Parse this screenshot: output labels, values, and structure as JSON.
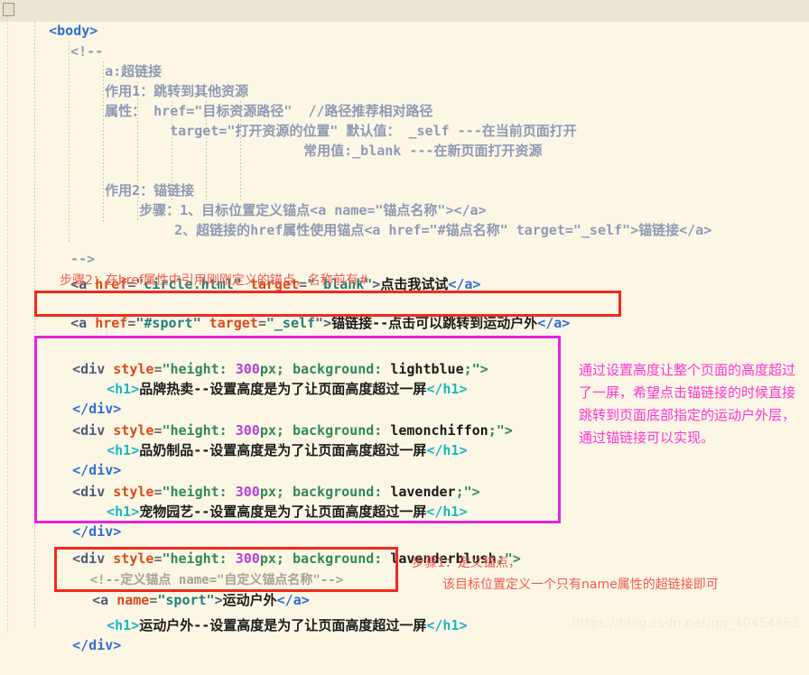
{
  "editor": {
    "language": "html",
    "background_color": "#fcf7e5",
    "current_line_highlight": "#eae5d2",
    "body_tag": "<body>",
    "comment_open": "<!--",
    "comment_close": "-->",
    "comment_lines": [
      "a:超链接",
      "作用1：跳转到其他资源",
      "属性： href=\"目标资源路径\"  //路径推荐相对路径",
      "target=\"打开资源的位置\" 默认值： _self ---在当前页面打开",
      "常用值:_blank ---在新页面打开资源",
      "作用2：锚链接",
      "步骤：1、目标位置定义锚点<a name=\"锚点名称\"></a>",
      "2、超链接的href属性使用锚点<a href=\"#锚点名称\" target=\"_self\">锚链接</a>"
    ],
    "link_circle": {
      "open": "<a ",
      "attr_href": "href",
      "eq": "=",
      "val_href": "\"circle.html\"",
      "attr_target": "target",
      "val_target": "\"_blank\"",
      "gt": ">",
      "text": "点击我试试",
      "close": "</a>"
    },
    "link_sport": {
      "open": "<a ",
      "attr_href": "href",
      "eq": "=",
      "val_href": "\"#sport\"",
      "attr_target": "target",
      "val_target": "\"_self\"",
      "gt": ">",
      "text": "锚链接--点击可以跳转到运动户外",
      "close": "</a>"
    },
    "anchor_def": {
      "comment": "<!--定义锚点 name=\"自定义锚点名称\"-->",
      "open": "<a ",
      "attr_name": "name",
      "eq": "=",
      "val_name": "\"sport\"",
      "gt": ">",
      "text": "运动户外",
      "close": "</a>"
    },
    "divs": [
      {
        "tag_open": "<div ",
        "attr": "style",
        "eq": "=",
        "quote": "\"",
        "prop1": "height: ",
        "num": "300",
        "unit": "px; ",
        "prop2": "background: ",
        "value": "lightblue",
        "tail": ";\">",
        "h1_open": "<h1>",
        "h1_text": "品牌热卖--设置高度是为了让页面高度超过一屏",
        "h1_close": "</h1>",
        "close": "</div>"
      },
      {
        "tag_open": "<div ",
        "attr": "style",
        "eq": "=",
        "quote": "\"",
        "prop1": "height: ",
        "num": "300",
        "unit": "px; ",
        "prop2": "background: ",
        "value": "lemonchiffon",
        "tail": ";\">",
        "h1_open": "<h1>",
        "h1_text": "品奶制品--设置高度是为了让页面高度超过一屏",
        "h1_close": "</h1>",
        "close": "</div>"
      },
      {
        "tag_open": "<div ",
        "attr": "style",
        "eq": "=",
        "quote": "\"",
        "prop1": "height: ",
        "num": "300",
        "unit": "px; ",
        "prop2": "background: ",
        "value": "lavender",
        "tail": ";\">",
        "h1_open": "<h1>",
        "h1_text": "宠物园艺--设置高度是为了让页面高度超过一屏",
        "h1_close": "</h1>",
        "close": "</div>"
      },
      {
        "tag_open": "<div ",
        "attr": "style",
        "eq": "=",
        "quote": "\"",
        "prop1": "height: ",
        "num": "300",
        "unit": "px; ",
        "prop2": "background: ",
        "value": "lavenderblush",
        "tail": ";\">",
        "h1_open": "<h1>",
        "h1_text": "运动户外--设置高度是为了让页面高度超过一屏",
        "h1_close": "</h1>",
        "close": "</div>"
      }
    ]
  },
  "annotations": {
    "step2_red": "步骤2：在href属性中引用刚刚定义的锚点，名称前有#",
    "step1_red_line1": "步骤1：定义锚点，",
    "step1_red_line2": "该目标位置定义一个只有name属性的超链接即可",
    "side_magenta": "通过设置高度让整个页面的高度超过了一屏，希望点击锚链接的时候直接跳转到页面底部指定的运动户外层，通过锚链接可以实现。",
    "colors": {
      "red_box": "#f5271f",
      "magenta_box": "#ea21e0",
      "red_text": "#f2584f",
      "magenta_text": "#ff34d2"
    }
  },
  "watermark": "https://blog.csdn.net/qq_40454863"
}
